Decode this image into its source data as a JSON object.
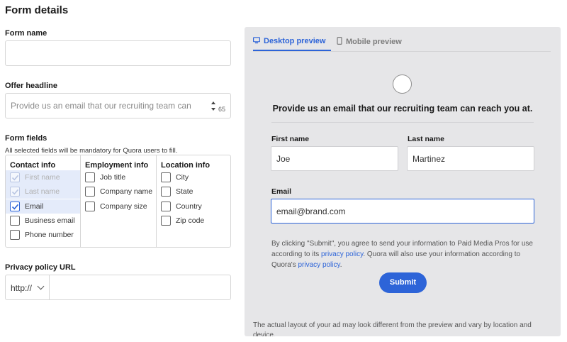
{
  "page": {
    "title": "Form details"
  },
  "form_name": {
    "label": "Form name",
    "value": ""
  },
  "offer_headline": {
    "label": "Offer headline",
    "value": "Provide us an email that our recruiting team can",
    "counter": "65"
  },
  "form_fields": {
    "label": "Form fields",
    "hint": "All selected fields will be mandatory for Quora users to fill.",
    "groups": [
      {
        "title": "Contact info",
        "options": [
          {
            "label": "First name",
            "checked": true,
            "disabled": true
          },
          {
            "label": "Last name",
            "checked": true,
            "disabled": true
          },
          {
            "label": "Email",
            "checked": true,
            "disabled": false
          },
          {
            "label": "Business email",
            "checked": false,
            "disabled": false
          },
          {
            "label": "Phone number",
            "checked": false,
            "disabled": false
          }
        ]
      },
      {
        "title": "Employment info",
        "options": [
          {
            "label": "Job title",
            "checked": false
          },
          {
            "label": "Company name",
            "checked": false
          },
          {
            "label": "Company size",
            "checked": false
          }
        ]
      },
      {
        "title": "Location info",
        "options": [
          {
            "label": "City",
            "checked": false
          },
          {
            "label": "State",
            "checked": false
          },
          {
            "label": "Country",
            "checked": false
          },
          {
            "label": "Zip code",
            "checked": false
          }
        ]
      }
    ]
  },
  "privacy_url": {
    "label": "Privacy policy URL",
    "protocol": "http://",
    "value": ""
  },
  "preview": {
    "tabs": [
      {
        "label": "Desktop preview",
        "active": true,
        "icon": "desktop-icon"
      },
      {
        "label": "Mobile preview",
        "active": false,
        "icon": "mobile-icon"
      }
    ],
    "headline": "Provide us an email that our recruiting team can reach you at.",
    "first_name": {
      "label": "First name",
      "value": "Joe"
    },
    "last_name": {
      "label": "Last name",
      "value": "Martinez"
    },
    "email": {
      "label": "Email",
      "value": "email@brand.com"
    },
    "consent": {
      "part1": "By clicking \"Submit\", you agree to send your information to Paid Media Pros for use according to its ",
      "link1": "privacy policy",
      "part2": ". Quora will also use your information according to Quora's ",
      "link2": "privacy policy",
      "part3": "."
    },
    "submit_label": "Submit",
    "disclaimer": "The actual layout of your ad may look different from the preview and vary by location and device."
  },
  "colors": {
    "accent": "#2d64d8",
    "preview_bg": "#e6e6e8",
    "highlight": "#e4ebfa"
  }
}
